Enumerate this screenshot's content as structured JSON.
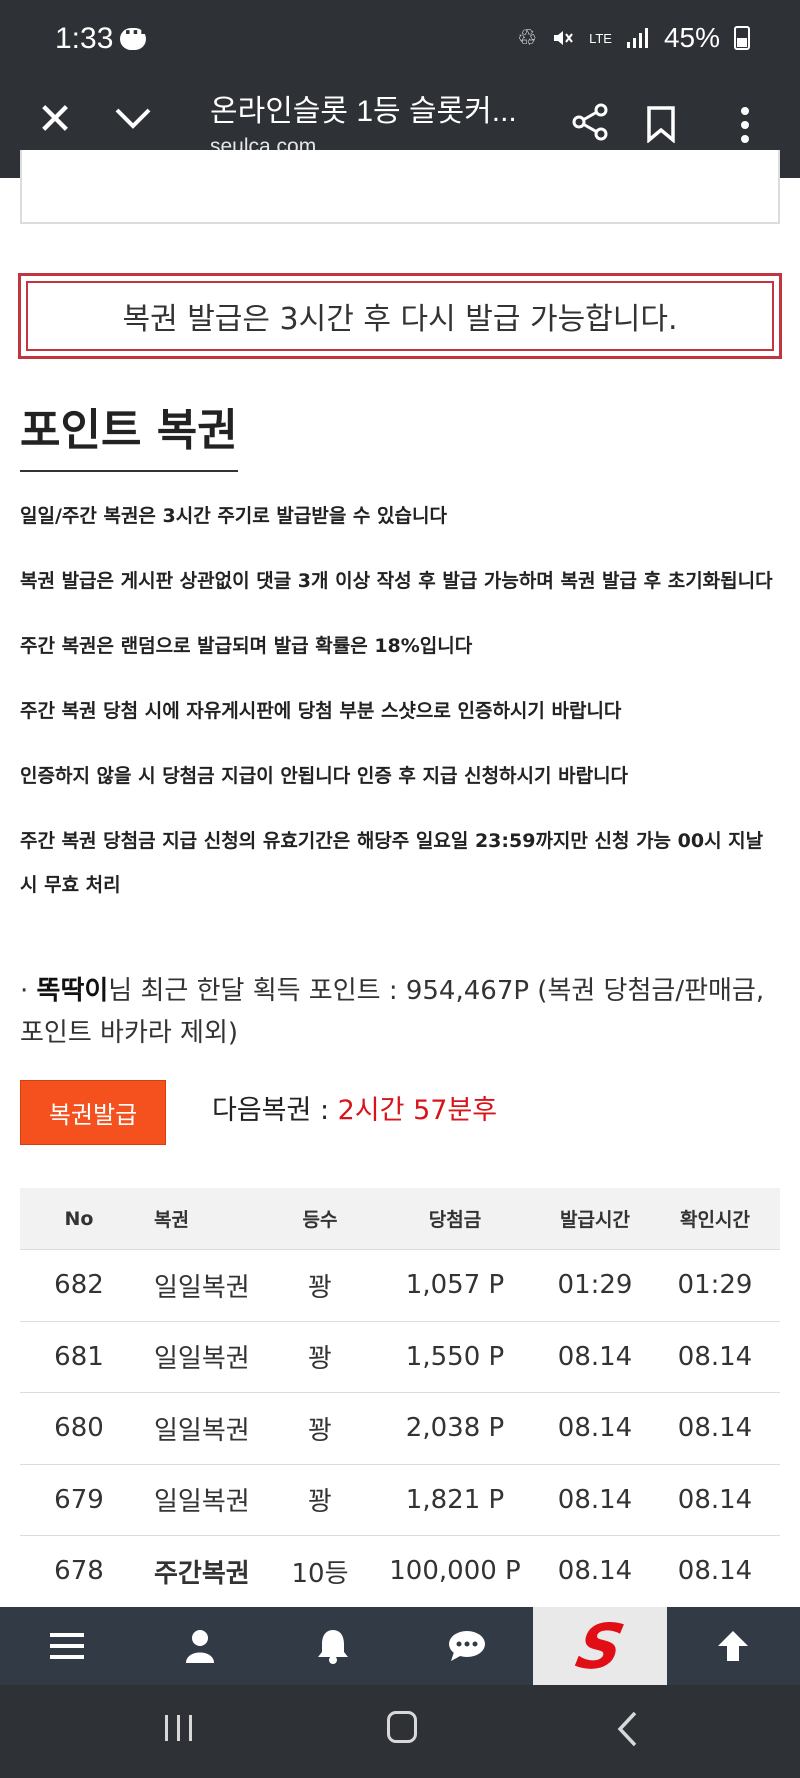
{
  "status_bar": {
    "time": "1:33",
    "network": "LTE",
    "battery": "45%"
  },
  "browser": {
    "title": "온라인슬롯 1등 슬롯커...",
    "url": "seulca.com"
  },
  "notice": {
    "text": "복권 발급은 3시간 후 다시 발급 가능합니다."
  },
  "section": {
    "title": "포인트 복권"
  },
  "rules": [
    "일일/주간 복권은 3시간 주기로 발급받을 수 있습니다",
    "복권 발급은 게시판 상관없이 댓글 3개 이상 작성 후 발급 가능하며 복권 발급 후 초기화됩니다",
    "주간 복권은 랜덤으로 발급되며 발급 확률은 18%입니다",
    "주간 복권 당첨 시에 자유게시판에 당첨 부분 스샷으로 인증하시기 바랍니다",
    "인증하지 않을 시 당첨금 지급이 안됩니다 인증 후 지급 신청하시기 바랍니다",
    "주간 복권 당첨금 지급 신청의 유효기간은 해당주 일요일 23:59까지만 신청 가능 00시 지날 시 무효 처리"
  ],
  "points": {
    "bullet": "·",
    "user": "똑딱이",
    "text": "님 최근 한달 획득 포인트 : 954,467P (복권 당첨금/판매금, 포인트 바카라 제외)"
  },
  "issue_button": {
    "label": "복권발급"
  },
  "next": {
    "label": "다음복권 : ",
    "value": "2시간 57분후"
  },
  "table": {
    "headers": {
      "no": "No",
      "name": "복권",
      "rank": "등수",
      "prize": "당첨금",
      "issued": "발급시간",
      "checked": "확인시간"
    },
    "rows": [
      {
        "no": "682",
        "name": "일일복권",
        "rank": "꽝",
        "prize": "1,057 P",
        "issued": "01:29",
        "checked": "01:29"
      },
      {
        "no": "681",
        "name": "일일복권",
        "rank": "꽝",
        "prize": "1,550 P",
        "issued": "08.14",
        "checked": "08.14"
      },
      {
        "no": "680",
        "name": "일일복권",
        "rank": "꽝",
        "prize": "2,038 P",
        "issued": "08.14",
        "checked": "08.14"
      },
      {
        "no": "679",
        "name": "일일복권",
        "rank": "꽝",
        "prize": "1,821 P",
        "issued": "08.14",
        "checked": "08.14"
      },
      {
        "no": "678",
        "name": "주간복권",
        "rank": "10등",
        "prize": "100,000 P",
        "issued": "08.14",
        "checked": "08.14"
      }
    ]
  },
  "site_nav": {
    "logo": "S",
    "icons": [
      "menu-icon",
      "user-icon",
      "bell-icon",
      "chat-icon",
      "site-logo",
      "arrow-up-icon"
    ]
  },
  "colors": {
    "bar_bg": "#2e3135",
    "site_nav_bg": "#323a45",
    "notice_border": "#c0353e",
    "button_bg": "#f4511e",
    "next_value": "#d8141a",
    "logo": "#e10e15"
  }
}
